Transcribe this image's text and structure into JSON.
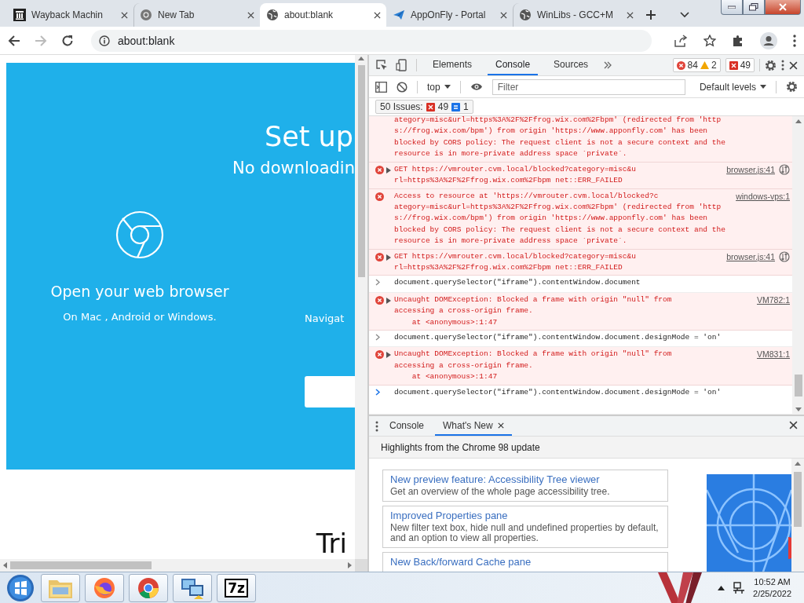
{
  "browser": {
    "tabs": [
      {
        "title": "Wayback Machin",
        "selected": false
      },
      {
        "title": "New Tab",
        "selected": false
      },
      {
        "title": "about:blank",
        "selected": true
      },
      {
        "title": "AppOnFly - Portal",
        "selected": false
      },
      {
        "title": "WinLibs - GCC+M",
        "selected": false
      }
    ],
    "address": "about:blank",
    "forward_disabled": true
  },
  "page": {
    "heading": "Set up",
    "subheading": "No downloadin",
    "step_title": "Open your web browser",
    "step_text": "On Mac , Android or Windows.",
    "step_2_text": "Navigat",
    "footer_heading": "Tri"
  },
  "devtools": {
    "tabs": [
      {
        "label": "Elements",
        "selected": false
      },
      {
        "label": "Console",
        "selected": true
      },
      {
        "label": "Sources",
        "selected": false
      }
    ],
    "error_count": "84",
    "warning_count": "2",
    "issue_count": "49",
    "context": "top",
    "filter_placeholder": "Filter",
    "levels": "Default levels",
    "issues_label": "50 Issues:",
    "issues_errors": "49",
    "issues_info": "1",
    "messages": [
      {
        "kind": "continuation",
        "expandable": false,
        "request": false,
        "lines": [
          "ategory=misc&url=https%3A%2F%2Ffrog.wix.com%2Fbpm' (redirected from 'http",
          "s://frog.wix.com/bpm') from origin 'https://www.apponfly.com' has been",
          "blocked by CORS policy: The request client is not a secure context and the",
          "resource is in more-private address space `private`."
        ]
      },
      {
        "kind": "error",
        "expandable": true,
        "request": true,
        "lines": [
          "GET https://vmrouter.cvm.local/blocked?category=misc&u",
          "rl=https%3A%2F%2Ffrog.wix.com%2Fbpm net::ERR_FAILED"
        ],
        "source": "browser.js:41"
      },
      {
        "kind": "error",
        "expandable": false,
        "request": false,
        "lines": [
          "Access to resource at 'https://vmrouter.cvm.local/blocked?c",
          "ategory=misc&url=https%3A%2F%2Ffrog.wix.com%2Fbpm' (redirected from 'http",
          "s://frog.wix.com/bpm') from origin 'https://www.apponfly.com' has been",
          "blocked by CORS policy: The request client is not a secure context and the",
          "resource is in more-private address space `private`."
        ],
        "source": "windows-vps:1"
      },
      {
        "kind": "error",
        "expandable": true,
        "request": true,
        "lines": [
          "GET https://vmrouter.cvm.local/blocked?category=misc&u",
          "rl=https%3A%2F%2Ffrog.wix.com%2Fbpm net::ERR_FAILED"
        ],
        "source": "browser.js:41"
      },
      {
        "kind": "input",
        "expandable": false,
        "request": false,
        "lines": [
          "document.querySelector(\"iframe\").contentWindow.document"
        ]
      },
      {
        "kind": "error",
        "expandable": true,
        "request": false,
        "lines": [
          "Uncaught DOMException: Blocked a frame with origin \"null\" from",
          "accessing a cross-origin frame.",
          "    at <anonymous>:1:47"
        ],
        "source": "VM782:1"
      },
      {
        "kind": "input",
        "expandable": false,
        "request": false,
        "lines": [
          "document.querySelector(\"iframe\").contentWindow.document.designMode = 'on'"
        ]
      },
      {
        "kind": "error",
        "expandable": true,
        "request": false,
        "lines": [
          "Uncaught DOMException: Blocked a frame with origin \"null\" from",
          "accessing a cross-origin frame.",
          "    at <anonymous>:1:47"
        ],
        "source": "VM831:1"
      },
      {
        "kind": "prompt",
        "expandable": false,
        "request": false,
        "lines": [
          "document.querySelector(\"iframe\").contentWindow.document.designMode = 'on'"
        ]
      }
    ],
    "drawer": {
      "tabs": [
        {
          "label": "Console",
          "selected": false,
          "closable": false
        },
        {
          "label": "What's New",
          "selected": true,
          "closable": true
        }
      ],
      "header": "Highlights from the Chrome 98 update",
      "cards": [
        {
          "title": "New preview feature: Accessibility Tree viewer",
          "text": "Get an overview of the whole page accessibility tree."
        },
        {
          "title": "Improved Properties pane",
          "text": "New filter text box, hide null and undefined properties by default, and an option to view all properties."
        },
        {
          "title": "New Back/forward Cache pane"
        }
      ]
    }
  },
  "taskbar": {
    "apps": [
      {
        "kind": "folder"
      },
      {
        "kind": "firefox"
      },
      {
        "kind": "chrome"
      },
      {
        "kind": "network"
      },
      {
        "kind": "archiver",
        "label": "7z"
      }
    ],
    "time": "10:52 AM",
    "date": "2/25/2022"
  }
}
